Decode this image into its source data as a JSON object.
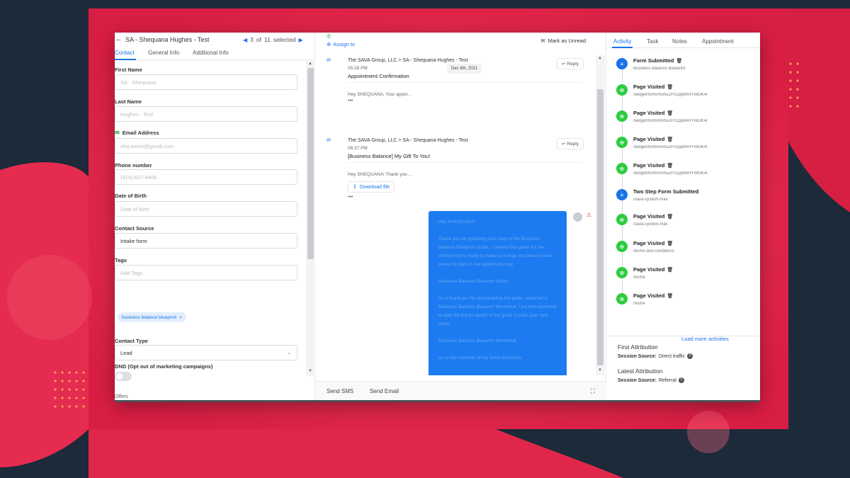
{
  "contact_header": {
    "back_icon": "arrow-left-icon",
    "title": "SA - Shequana Hughes - Test",
    "pager_current": "3",
    "pager_of": "of",
    "pager_total": "11",
    "pager_selected": "selected"
  },
  "contact_tabs": [
    "Contact",
    "General Info",
    "Additional Info"
  ],
  "form": {
    "first_name_label": "First Name",
    "first_name_value": "SA - Shequana",
    "last_name_label": "Last Name",
    "last_name_value": "Hughes - Test",
    "email_label": "Email Address",
    "email_value": "shq.assist@gmail.com",
    "phone_label": "Phone number",
    "phone_value": "(314) 627-8466",
    "dob_label": "Date of Birth",
    "dob_placeholder": "Date of birth",
    "source_label": "Contact Source",
    "source_value": "Intake form",
    "tags_label": "Tags",
    "tags_placeholder": "Add Tags",
    "tag_chip": "business balance blueprint",
    "tag_chip_close": "×",
    "type_label": "Contact Type",
    "type_value": "Lead",
    "dnd_label": "DND (Opt out of marketing campaigns)",
    "offers_label": "Offers"
  },
  "conversation": {
    "assign_label": "Assign to",
    "mark_unread": "Mark as Unread",
    "date_chip": "Dec 6th, 2021",
    "messages": [
      {
        "from": "The SAVA Group, LLC > SA - Shequana Hughes - Test",
        "time": "05:28 PM",
        "subject": "Appointment Confirmation",
        "preview": "Hey SHEQUANA, Your appoi...",
        "dots": "•••",
        "reply": "Reply"
      },
      {
        "from": "The SAVA Group, LLC > SA - Shequana Hughes - Test",
        "time": "08:37 PM",
        "subject": "[Business Balance] My Gift To You!",
        "preview": "Hey SHEQUANA! Thank you ...",
        "dots": "•••",
        "reply": "Reply",
        "download": "Download file"
      }
    ],
    "bubble_paragraphs": [
      "Hey SHEQUANA!",
      "Thank you for grabbing your copy of the Business Balance Blueprint Guide. I created this guide for the woman who's ready to make a change but doesn't know where to start on her system journey.",
      "Business Balance Blueprint Guide",
      "As a thank you for downloading the guide, attached is Business Balance Blueprint Workbook. Use this workbook to take the things taught in the guide to plan your next steps.",
      "Business Balance Blueprint Workbook",
      "As a new member of my SAVA Exclusive"
    ],
    "composer_tabs": [
      "Send SMS",
      "Send Email"
    ]
  },
  "activity_tabs": [
    "Activity",
    "Task",
    "Notes",
    "Appointment"
  ],
  "activities": [
    {
      "title": "Form Submitted",
      "sub": "Business Balance Blueprint",
      "kind": "form"
    },
    {
      "title": "Page Visited",
      "sub": "/widget/form/mnhuZPc1ppMAYFMOK4i",
      "kind": "page"
    },
    {
      "title": "Page Visited",
      "sub": "/widget/form/mnhuZPc1ppMAYFMOK4i",
      "kind": "page"
    },
    {
      "title": "Page Visited",
      "sub": "/widget/form/mnhuZPc1ppMAYFMOK4i",
      "kind": "page"
    },
    {
      "title": "Page Visited",
      "sub": "/widget/form/mnhuZPc1ppMAYFMOK4i",
      "kind": "page"
    },
    {
      "title": "Two Step Form Submitted",
      "sub": "/sava-system-max",
      "kind": "twostep"
    },
    {
      "title": "Page Visited",
      "sub": "/sava-system-max",
      "kind": "page"
    },
    {
      "title": "Page Visited",
      "sub": "/terms-and-conditions",
      "kind": "page"
    },
    {
      "title": "Page Visited",
      "sub": "/home",
      "kind": "page"
    },
    {
      "title": "Page Visited",
      "sub": "/home",
      "kind": "page"
    }
  ],
  "load_more": "Load more activities",
  "first_attribution": {
    "title": "First Attribution",
    "label": "Session Source:",
    "value": "Direct traffic"
  },
  "latest_attribution": {
    "title": "Latest Attribution",
    "label": "Session Source:",
    "value": "Referral"
  },
  "colors": {
    "accent": "#1a73e8",
    "success": "#27ae60",
    "bubble": "#1c7bf0",
    "brand_bg": "#e8284f",
    "dark_bg": "#1c2a39"
  }
}
